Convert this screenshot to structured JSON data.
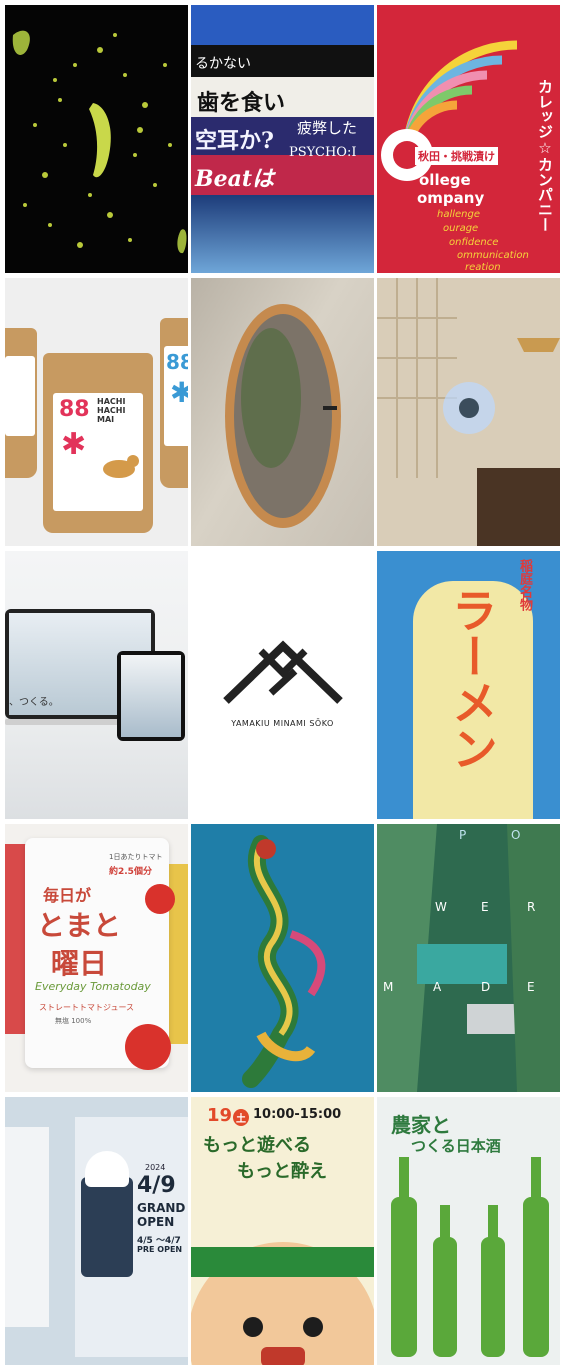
{
  "tiles": [
    {
      "id": "abstract-banana"
    },
    {
      "id": "collage-poster",
      "lines": [
        "るかない",
        "歯を食い",
        "空耳か?",
        "Beatは",
        "疲弊した",
        "PSYCHO:I"
      ]
    },
    {
      "id": "college-company",
      "vertical": "カレッジ☆カンパニー",
      "badge": "秋田・挑戦漬け",
      "words": [
        "ollege",
        "ompany",
        "hallenge",
        "ourage",
        "onfidence",
        "ommunication",
        "reation"
      ]
    },
    {
      "id": "hachi-rice-bags",
      "brand": "88",
      "name_lines": [
        "HACHI",
        "HACHI",
        "MAI"
      ]
    },
    {
      "id": "round-mirror"
    },
    {
      "id": "interior-room"
    },
    {
      "id": "website-mockup",
      "snippet": "、つくる。"
    },
    {
      "id": "yamakiu-logo",
      "logo_text": "YAMAKIU MINAMI SŌKO"
    },
    {
      "id": "ramen-poster",
      "title": "ラーメン",
      "tag": "稲庭名物"
    },
    {
      "id": "tomato-juice",
      "badge_line1": "1日あたりトマト",
      "badge_line2": "約2.5個分",
      "title_lines": [
        "毎日が",
        "とまと",
        "曜日"
      ],
      "script": "Everyday Tomatoday",
      "subtitle": "ストレートトマトジュース",
      "volume": "無塩 100%"
    },
    {
      "id": "dragon-poster"
    },
    {
      "id": "aerial-dam",
      "letters": [
        "P",
        "O",
        "W",
        "E",
        "R",
        "M",
        "A",
        "D",
        "E"
      ]
    },
    {
      "id": "grand-open-poster",
      "date": "4/9",
      "year": "2024",
      "grand": "GRAND",
      "open": "OPEN",
      "range": "4/5 〜4/7",
      "pre": "PRE OPEN"
    },
    {
      "id": "event-poster",
      "day": "19",
      "weekday": "土",
      "time": "10:00-15:00",
      "line1": "もっと遊べる",
      "line2": "もっと酔え"
    },
    {
      "id": "sake-bottles",
      "title_line1": "農家と",
      "title_line2": "つくる日本酒"
    }
  ]
}
